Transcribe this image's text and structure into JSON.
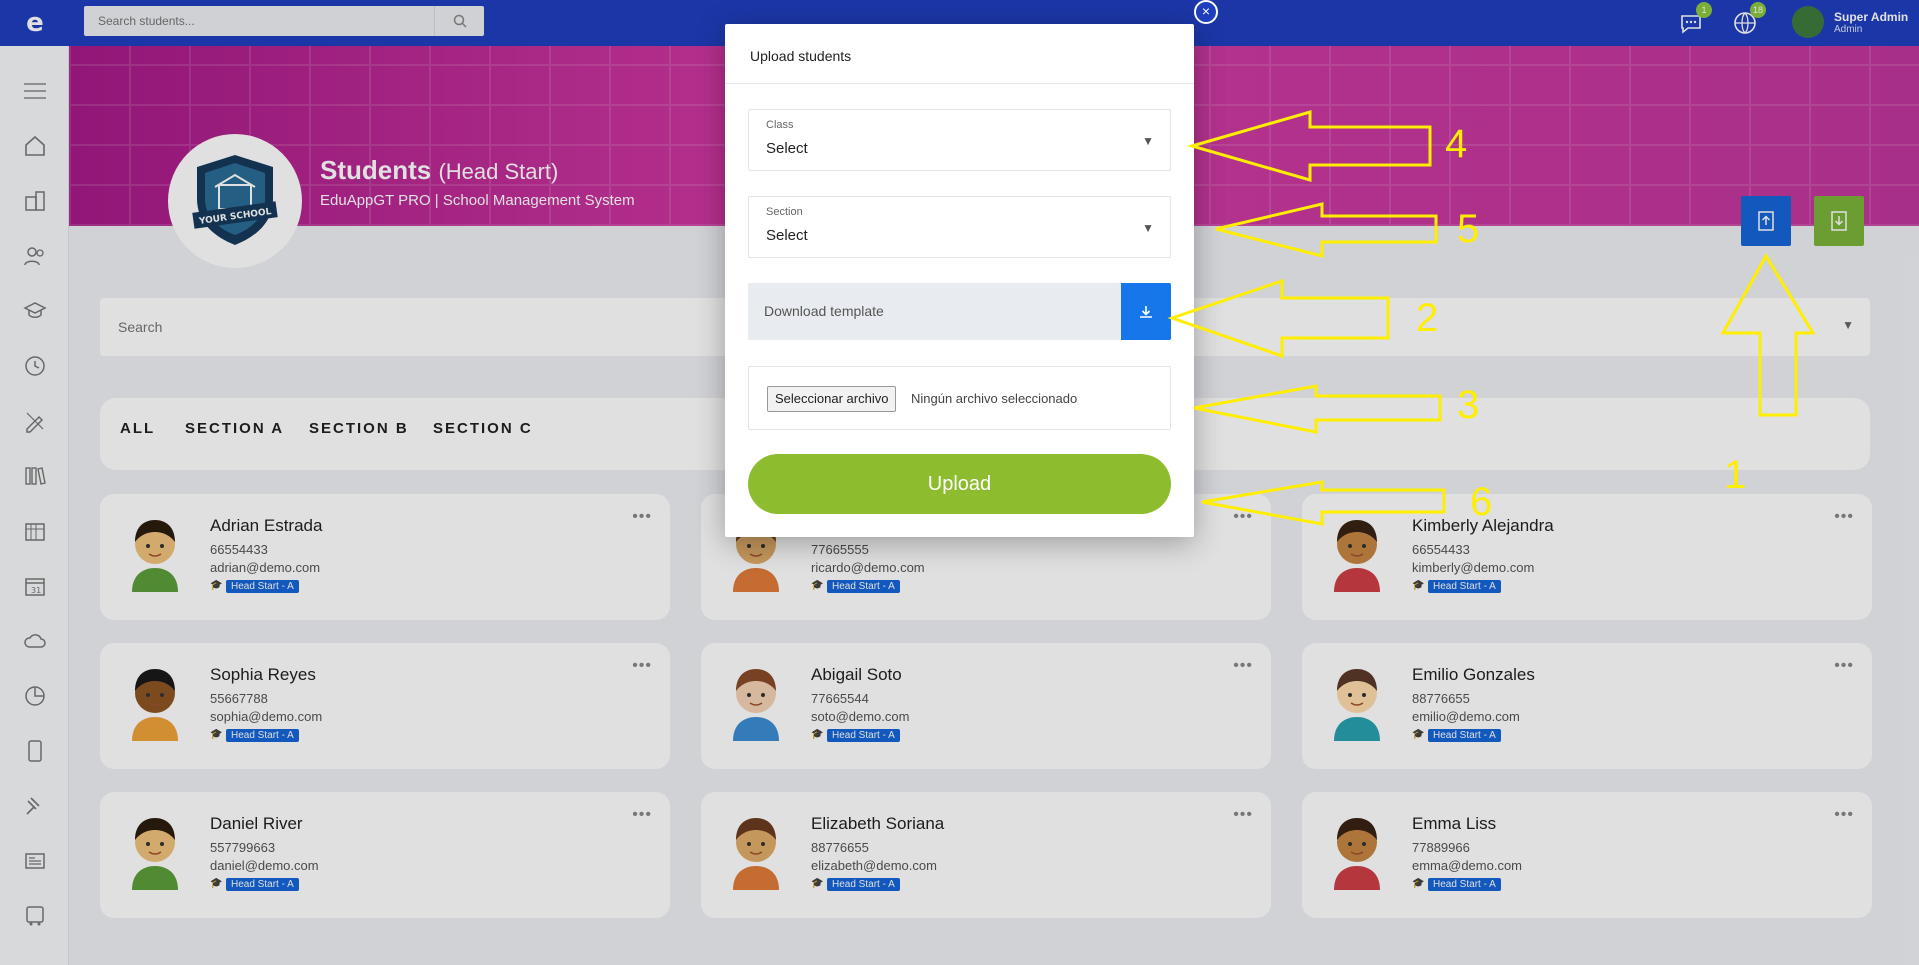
{
  "topbar": {
    "logo": "e",
    "search_placeholder": "Search students...",
    "messages_badge": "1",
    "notifications_badge": "18",
    "user_name": "Super Admin",
    "user_role": "Admin"
  },
  "header": {
    "title": "Students",
    "title_sub": "(Head Start)",
    "subtitle": "EduAppGT PRO | School Management System",
    "school_logo_text": "YOUR SCHOOL"
  },
  "filter": {
    "placeholder": "Search"
  },
  "tabs": [
    "ALL",
    "SECTION A",
    "SECTION B",
    "SECTION C"
  ],
  "students": [
    {
      "name": "Adrian Estrada",
      "phone": "66554433",
      "email": "adrian@demo.com",
      "tag": "Head Start - A"
    },
    {
      "name": "",
      "phone": "77665555",
      "email": "ricardo@demo.com",
      "tag": "Head Start - A"
    },
    {
      "name": "Kimberly Alejandra",
      "phone": "66554433",
      "email": "kimberly@demo.com",
      "tag": "Head Start - A"
    },
    {
      "name": "Sophia Reyes",
      "phone": "55667788",
      "email": "sophia@demo.com",
      "tag": "Head Start - A"
    },
    {
      "name": "Abigail Soto",
      "phone": "77665544",
      "email": "soto@demo.com",
      "tag": "Head Start - A"
    },
    {
      "name": "Emilio Gonzales",
      "phone": "88776655",
      "email": "emilio@demo.com",
      "tag": "Head Start - A"
    },
    {
      "name": "Daniel River",
      "phone": "557799663",
      "email": "daniel@demo.com",
      "tag": "Head Start - A"
    },
    {
      "name": "Elizabeth Soriana",
      "phone": "88776655",
      "email": "elizabeth@demo.com",
      "tag": "Head Start - A"
    },
    {
      "name": "Emma Liss",
      "phone": "77889966",
      "email": "emma@demo.com",
      "tag": "Head Start - A"
    }
  ],
  "modal": {
    "title": "Upload students",
    "close": "×",
    "class_label": "Class",
    "class_value": "Select",
    "section_label": "Section",
    "section_value": "Select",
    "download_label": "Download template",
    "file_button": "Seleccionar archivo",
    "file_status": "Ningún archivo seleccionado",
    "upload_label": "Upload"
  },
  "annotations": [
    "1",
    "2",
    "3",
    "4",
    "5",
    "6"
  ],
  "colors": {
    "topbar": "#1f3fbf",
    "banner": "#c0369c",
    "upload": "#8dbd2f",
    "download": "#1677ea",
    "annotation": "#ffee00"
  }
}
